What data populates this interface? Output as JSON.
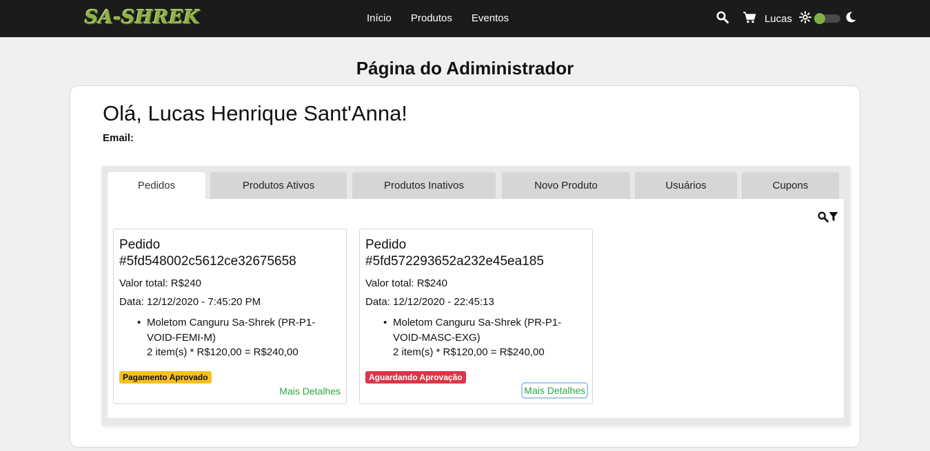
{
  "navbar": {
    "logo": "SA-SHREK",
    "links": [
      "Início",
      "Produtos",
      "Eventos"
    ],
    "user": "Lucas",
    "icons": [
      "search-icon",
      "cart-icon",
      "sun-icon",
      "moon-icon"
    ],
    "accent": "#7cb342"
  },
  "page": {
    "title": "Página do Adiministrador"
  },
  "profile": {
    "greeting": "Olá, Lucas Henrique Sant'Anna!",
    "email_label": "Email:"
  },
  "tabs": [
    "Pedidos",
    "Produtos Ativos",
    "Produtos Inativos",
    "Novo Produto",
    "Usuários",
    "Cupons"
  ],
  "orders": [
    {
      "title_line1": "Pedido",
      "title_line2": "#5fd548002c5612ce32675658",
      "total": "Valor total: R$240",
      "date": "Data: 12/12/2020 - 7:45:20 PM",
      "item_line1": "Moletom Canguru Sa-Shrek (PR-P1-",
      "item_line2": "VOID-FEMI-M)",
      "item_line3": "2 item(s) * R$120,00 = R$240,00",
      "status": "Pagamento Aprovado",
      "status_color": "#f5c021",
      "details": "Mais Detalhes"
    },
    {
      "title_line1": "Pedido",
      "title_line2": "#5fd572293652a232e45ea185",
      "total": "Valor total: R$240",
      "date": "Data: 12/12/2020 - 22:45:13",
      "item_line1": "Moletom Canguru Sa-Shrek (PR-P1-",
      "item_line2": "VOID-MASC-EXG)",
      "item_line3": "2 item(s) * R$120,00 = R$240,00",
      "status": "Aguardando Aprovação",
      "status_color": "#dc3545",
      "details": "Mais Detalhes"
    }
  ],
  "colors": {
    "navbar_bg": "#1b1b1b",
    "page_bg": "#f0eff2",
    "link_green": "#28a745"
  }
}
